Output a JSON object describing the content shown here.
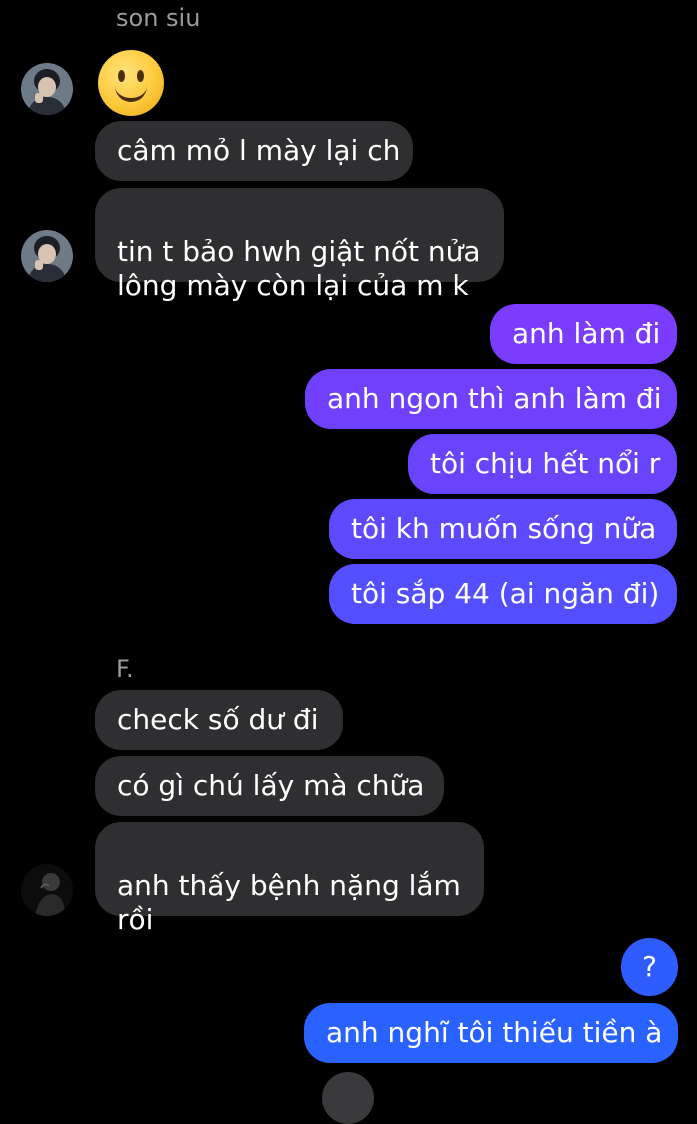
{
  "conversation": {
    "groups": [
      {
        "sender": "son siu",
        "messages": [
          {
            "type": "emoji",
            "icon": "slightly-smiling-face-emoji"
          },
          {
            "text": "câm mỏ l mày lại ch"
          },
          {
            "text": "tin t bảo hwh giật nốt nửa\nlông mày còn lại của m k"
          }
        ]
      },
      {
        "sender": "me",
        "messages": [
          {
            "text": "anh làm đi"
          },
          {
            "text": "anh ngon thì anh làm đi"
          },
          {
            "text": "tôi chịu hết nổi r"
          },
          {
            "text": "tôi kh muốn sống nữa"
          },
          {
            "text": "tôi sắp 44 (ai ngăn đi)"
          }
        ]
      },
      {
        "sender": "F.",
        "messages": [
          {
            "text": "check số dư đi"
          },
          {
            "text": "có gì chú lấy mà chữa"
          },
          {
            "text": "anh thấy bệnh nặng lắm\nrồi"
          }
        ]
      },
      {
        "sender": "me",
        "messages": [
          {
            "text": "?"
          },
          {
            "text": "anh nghĩ tôi thiếu tiền à"
          }
        ]
      }
    ]
  },
  "colors": {
    "incoming_bubble": "#2f2f31",
    "outgoing_gradient_top": "#8a2eff",
    "outgoing_gradient_bottom": "#1f66ff",
    "sender_name": "#9b9b9b",
    "background": "#000000"
  }
}
